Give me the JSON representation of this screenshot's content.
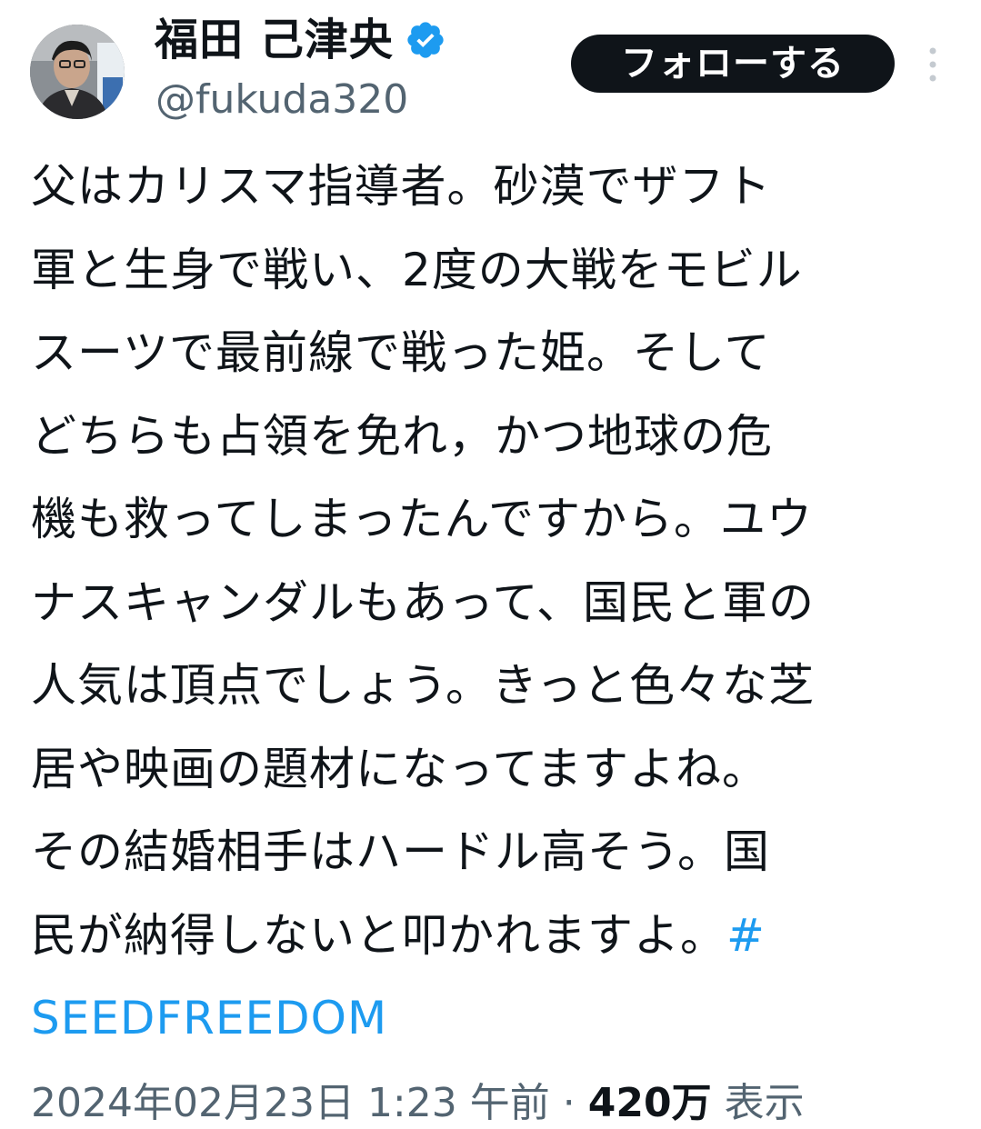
{
  "profile": {
    "display_name": "福田 己津央",
    "handle": "@fukuda320",
    "verified_icon": "verified-badge-icon",
    "follow_label": "フォローする",
    "more_icon": "vertical-ellipsis-icon"
  },
  "tweet": {
    "lines": [
      "父はカリスマ指導者。砂漠でザフト",
      "軍と生身で戦い、2度の大戦をモビル",
      "スーツで最前線で戦った姫。そして",
      "どちらも占領を免れ，かつ地球の危",
      "機も救ってしまったんですから。ユウ",
      "ナスキャンダルもあって、国民と軍の",
      "人気は頂点でしょう。きっと色々な芝",
      "居や映画の題材になってますよね。",
      "その結婚相手はハードル高そう。国",
      "民が納得しないと叩かれますよ。"
    ],
    "hashtag_symbol": "#",
    "hashtag_text": "SEEDFREEDOM"
  },
  "meta": {
    "timestamp": "2024年02月23日 1:23 午前",
    "views": "420万",
    "views_label": "表示"
  },
  "colors": {
    "accent": "#1d9bf0",
    "text": "#0f1419",
    "secondary": "#536471",
    "button": "#0f1419"
  }
}
